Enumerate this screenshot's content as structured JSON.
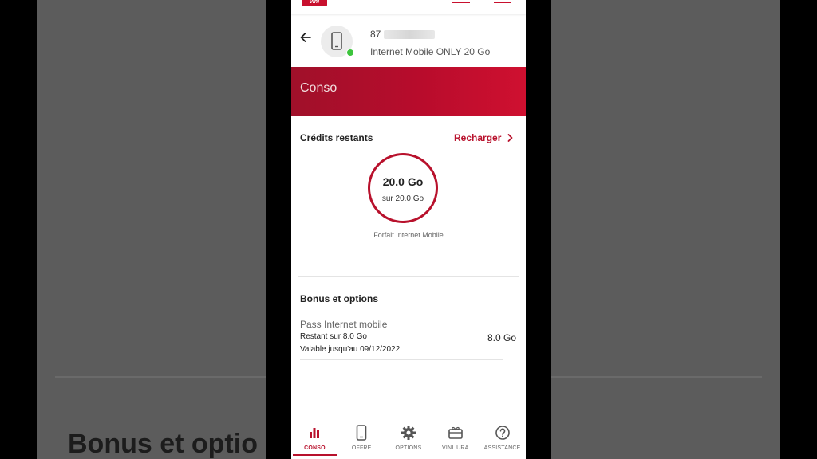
{
  "brand": {
    "logo_text": "vini",
    "accent": "#b8112c"
  },
  "header": {
    "number_prefix": "87",
    "plan_name": "Internet Mobile ONLY 20 Go"
  },
  "banner": {
    "title": "Conso"
  },
  "credits": {
    "title": "Crédits restants",
    "action_label": "Recharger",
    "value_label": "20.0 Go",
    "total_label": "sur 20.0 Go",
    "remaining_fraction": 1.0,
    "caption": "Forfait Internet Mobile"
  },
  "bonus": {
    "title": "Bonus et options",
    "items": [
      {
        "name": "Pass Internet mobile",
        "remaining": "Restant sur 8.0 Go",
        "validity": "Valable jusqu'au 09/12/2022",
        "amount": "8.0 Go"
      }
    ]
  },
  "background": {
    "heading": "Bonus et optio"
  },
  "nav": {
    "items": [
      {
        "label": "CONSO",
        "icon": "bar-chart-icon",
        "active": true
      },
      {
        "label": "OFFRE",
        "icon": "smartphone-icon",
        "active": false
      },
      {
        "label": "OPTIONS",
        "icon": "gear-icon",
        "active": false
      },
      {
        "label": "VINI 'URA",
        "icon": "gift-card-icon",
        "active": false
      },
      {
        "label": "ASSISTANCE",
        "icon": "help-circle-icon",
        "active": false
      }
    ]
  }
}
